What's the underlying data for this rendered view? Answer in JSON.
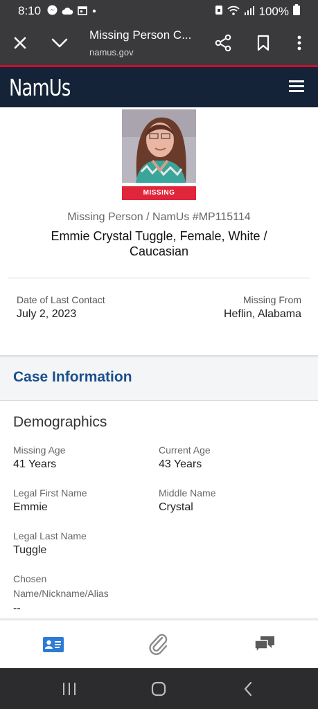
{
  "status_bar": {
    "time": "8:10",
    "battery": "100%"
  },
  "browser": {
    "title": "Missing Person C...",
    "url": "namus.gov",
    "icons": [
      "close-icon",
      "chevron-down-icon",
      "share-icon",
      "bookmark-icon",
      "more-vert-icon"
    ]
  },
  "site": {
    "logo": "NamUs",
    "accent_color": "#c8102e",
    "header_color": "#142337"
  },
  "case": {
    "missing_badge": "MISSING",
    "case_id": "Missing Person / NamUs #MP115114",
    "name_line": "Emmie Crystal Tuggle, Female, White / Caucasian",
    "date_label": "Date of Last Contact",
    "date_value": "July 2, 2023",
    "from_label": "Missing From",
    "from_value": "Heflin, Alabama"
  },
  "case_information": {
    "title": "Case Information",
    "title_color": "#1a4f8c"
  },
  "demographics": {
    "title": "Demographics",
    "missing_age_label": "Missing Age",
    "missing_age_value": "41 Years",
    "current_age_label": "Current Age",
    "current_age_value": "43 Years",
    "first_name_label": "Legal First Name",
    "first_name_value": "Emmie",
    "middle_name_label": "Middle Name",
    "middle_name_value": "Crystal",
    "last_name_label": "Legal Last Name",
    "last_name_value": "Tuggle",
    "alias_label": "Chosen Name/Nickname/Alias",
    "alias_value": "--"
  },
  "bottom_nav": {
    "items": [
      "id-card-icon",
      "paperclip-icon",
      "chat-icon"
    ],
    "active_color": "#2d7bd4"
  }
}
